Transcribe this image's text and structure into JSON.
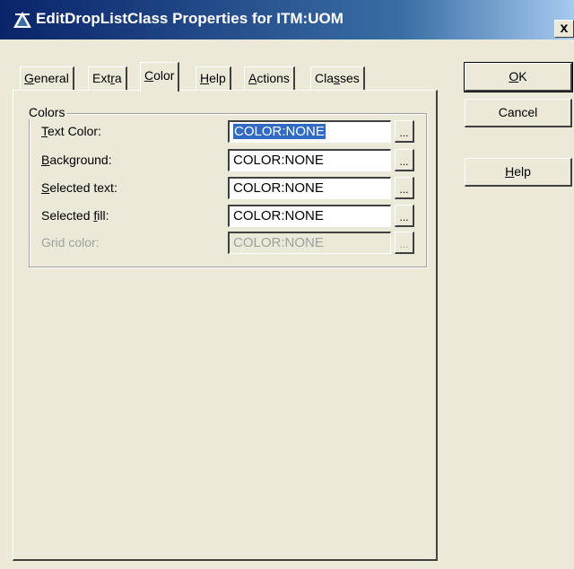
{
  "window": {
    "title": "EditDropListClass Properties for ITM:UOM",
    "close_label": "x"
  },
  "tabs": [
    {
      "pre": "",
      "key": "G",
      "post": "eneral"
    },
    {
      "pre": "Ext",
      "key": "r",
      "post": "a"
    },
    {
      "pre": "",
      "key": "C",
      "post": "olor"
    },
    {
      "pre": "",
      "key": "H",
      "post": "elp"
    },
    {
      "pre": "",
      "key": "A",
      "post": "ctions"
    },
    {
      "pre": "Cla",
      "key": "s",
      "post": "ses"
    }
  ],
  "active_tab": "Color",
  "colors_group": {
    "legend": "Colors",
    "rows": [
      {
        "pre": "",
        "key": "T",
        "post": "ext Color:",
        "value": "COLOR:NONE",
        "ellipsis": "...",
        "enabled": true,
        "selected": true
      },
      {
        "pre": "",
        "key": "B",
        "post": "ackground:",
        "value": "COLOR:NONE",
        "ellipsis": "...",
        "enabled": true
      },
      {
        "pre": "",
        "key": "S",
        "post": "elected text:",
        "value": "COLOR:NONE",
        "ellipsis": "...",
        "enabled": true
      },
      {
        "pre": "Selected ",
        "key": "f",
        "post": "ill:",
        "value": "COLOR:NONE",
        "ellipsis": "...",
        "enabled": true
      },
      {
        "pre": "Grid color:",
        "key": "",
        "post": "",
        "value": "COLOR:NONE",
        "ellipsis": "...",
        "enabled": false
      }
    ]
  },
  "buttons": {
    "ok": {
      "pre": "",
      "key": "O",
      "post": "K"
    },
    "cancel": {
      "label": "Cancel"
    },
    "help": {
      "pre": "",
      "key": "H",
      "post": "elp"
    }
  },
  "colors": {
    "face": "#ece9d8",
    "title_start": "#0a246a",
    "title_end": "#a6caf0",
    "selection": "#316ac5",
    "disabled_text": "#a0a0a0"
  }
}
